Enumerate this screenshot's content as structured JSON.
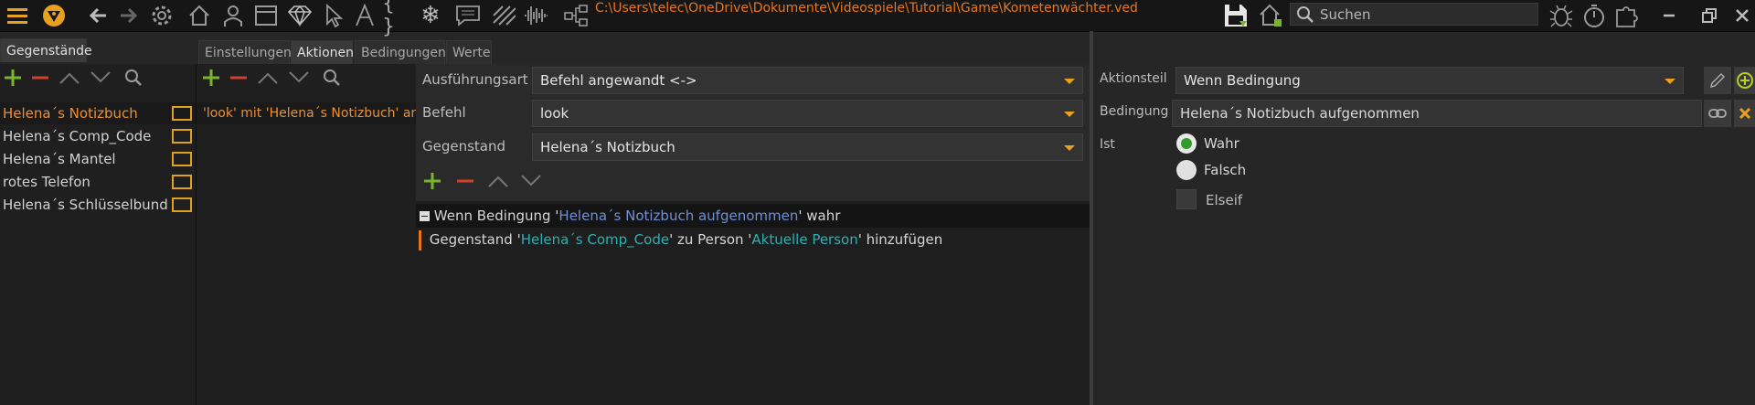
{
  "toolbar": {
    "icons": [
      "menu-icon",
      "logo-icon",
      "back-icon",
      "forward-icon",
      "settings-icon",
      "home-icon",
      "person-icon",
      "window-icon",
      "diamond-icon",
      "cursor-icon",
      "text-icon",
      "braces-icon",
      "snowflake-icon",
      "comment-icon",
      "stripes-icon",
      "waveform-icon",
      "hierarchy-icon"
    ],
    "file_path": "C:\\Users\\telec\\OneDrive\\Dokumente\\Videospiele\\Tutorial\\Game\\Kometenwächter.ved",
    "search_placeholder": "Suchen",
    "right_icons": [
      "save-icon",
      "home-export-icon",
      "bug-icon",
      "timer-icon",
      "puzzle-icon",
      "minimize-icon",
      "restore-icon",
      "close-icon"
    ],
    "colors": {
      "accent": "#e8761c",
      "background": "#161616"
    }
  },
  "items_panel": {
    "tab_label": "Gegenstände",
    "items": [
      {
        "label": "Helena´s Notizbuch",
        "selected": true
      },
      {
        "label": "Helena´s Comp_Code",
        "selected": false
      },
      {
        "label": "Helena´s Mantel",
        "selected": false
      },
      {
        "label": "rotes Telefon",
        "selected": false
      },
      {
        "label": "Helena´s Schlüsselbund",
        "selected": false
      }
    ]
  },
  "tabs": [
    "Einstellungen",
    "Aktionen",
    "Bedingungen",
    "Werte"
  ],
  "active_tab": "Aktionen",
  "actions_panel": {
    "items": [
      {
        "label": "'look' mit 'Helena´s Notizbuch' an",
        "selected": true
      }
    ]
  },
  "action_form": {
    "execution_label": "Ausführungsart",
    "execution_value": "Befehl angewandt <->",
    "command_label": "Befehl",
    "command_value": "look",
    "item_label": "Gegenstand",
    "item_value": "Helena´s Notizbuch"
  },
  "action_tree": {
    "row1": {
      "prefix": "Wenn Bedingung '",
      "link": "Helena´s Notizbuch aufgenommen",
      "suffix": "' wahr"
    },
    "row2": {
      "prefix": "Gegenstand '",
      "item": "Helena´s Comp_Code",
      "middle": "' zu Person '",
      "person": "Aktuelle Person",
      "suffix": "' hinzufügen"
    }
  },
  "right_panel": {
    "part_label": "Aktionsteil",
    "part_value": "Wenn Bedingung",
    "condition_label": "Bedingung",
    "condition_value": "Helena´s Notizbuch aufgenommen",
    "is_label": "Ist",
    "radio_true": "Wahr",
    "radio_false": "Falsch",
    "selected_radio": "Wahr",
    "elseif_label": "Elseif",
    "elseif_checked": false
  }
}
